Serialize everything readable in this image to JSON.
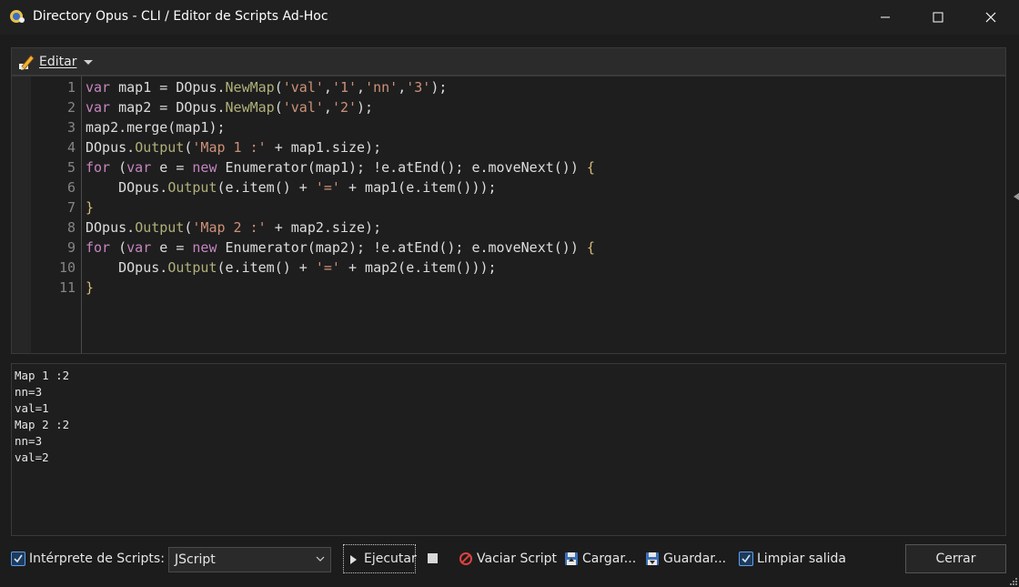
{
  "window": {
    "title": "Directory Opus - CLI / Editor de Scripts Ad-Hoc"
  },
  "toolbar": {
    "edit_label": "Editar"
  },
  "editor": {
    "line_numbers": [
      "1",
      "2",
      "3",
      "4",
      "5",
      "6",
      "7",
      "8",
      "9",
      "10",
      "11"
    ],
    "lines": [
      [
        {
          "t": "kw",
          "v": "var"
        },
        {
          "t": "text",
          "v": " map1 = DOpus."
        },
        {
          "t": "fn",
          "v": "NewMap"
        },
        {
          "t": "text",
          "v": "("
        },
        {
          "t": "str",
          "v": "'val'"
        },
        {
          "t": "text",
          "v": ","
        },
        {
          "t": "str",
          "v": "'1'"
        },
        {
          "t": "text",
          "v": ","
        },
        {
          "t": "str",
          "v": "'nn'"
        },
        {
          "t": "text",
          "v": ","
        },
        {
          "t": "str",
          "v": "'3'"
        },
        {
          "t": "text",
          "v": ");"
        }
      ],
      [
        {
          "t": "kw",
          "v": "var"
        },
        {
          "t": "text",
          "v": " map2 = DOpus."
        },
        {
          "t": "fn",
          "v": "NewMap"
        },
        {
          "t": "text",
          "v": "("
        },
        {
          "t": "str",
          "v": "'val'"
        },
        {
          "t": "text",
          "v": ","
        },
        {
          "t": "str",
          "v": "'2'"
        },
        {
          "t": "text",
          "v": ");"
        }
      ],
      [
        {
          "t": "text",
          "v": "map2.merge(map1);"
        }
      ],
      [
        {
          "t": "text",
          "v": "DOpus."
        },
        {
          "t": "fn",
          "v": "Output"
        },
        {
          "t": "text",
          "v": "("
        },
        {
          "t": "str",
          "v": "'Map 1 :'"
        },
        {
          "t": "text",
          "v": " + map1.size);"
        }
      ],
      [
        {
          "t": "kw",
          "v": "for"
        },
        {
          "t": "text",
          "v": " ("
        },
        {
          "t": "kw",
          "v": "var"
        },
        {
          "t": "text",
          "v": " e = "
        },
        {
          "t": "kw",
          "v": "new"
        },
        {
          "t": "text",
          "v": " Enumerator(map1); !e.atEnd(); e.moveNext()) "
        },
        {
          "t": "brace",
          "v": "{"
        }
      ],
      [
        {
          "t": "text",
          "v": "    DOpus."
        },
        {
          "t": "fn",
          "v": "Output"
        },
        {
          "t": "text",
          "v": "(e.item() + "
        },
        {
          "t": "str",
          "v": "'='"
        },
        {
          "t": "text",
          "v": " + map1(e.item()));"
        }
      ],
      [
        {
          "t": "brace",
          "v": "}"
        }
      ],
      [
        {
          "t": "text",
          "v": "DOpus."
        },
        {
          "t": "fn",
          "v": "Output"
        },
        {
          "t": "text",
          "v": "("
        },
        {
          "t": "str",
          "v": "'Map 2 :'"
        },
        {
          "t": "text",
          "v": " + map2.size);"
        }
      ],
      [
        {
          "t": "kw",
          "v": "for"
        },
        {
          "t": "text",
          "v": " ("
        },
        {
          "t": "kw",
          "v": "var"
        },
        {
          "t": "text",
          "v": " e = "
        },
        {
          "t": "kw",
          "v": "new"
        },
        {
          "t": "text",
          "v": " Enumerator(map2); !e.atEnd(); e.moveNext()) "
        },
        {
          "t": "brace",
          "v": "{"
        }
      ],
      [
        {
          "t": "text",
          "v": "    DOpus."
        },
        {
          "t": "fn",
          "v": "Output"
        },
        {
          "t": "text",
          "v": "(e.item() + "
        },
        {
          "t": "str",
          "v": "'='"
        },
        {
          "t": "text",
          "v": " + map2(e.item()));"
        }
      ],
      [
        {
          "t": "brace",
          "v": "}"
        }
      ]
    ]
  },
  "output": {
    "lines": [
      "Map 1 :2",
      "nn=3",
      "val=1",
      "Map 2 :2",
      "nn=3",
      "val=2"
    ]
  },
  "bottom": {
    "interpreter_label": "Intérprete de Scripts:",
    "interpreter_checked": true,
    "interpreter_value": "JScript",
    "run_label": "Ejecutar",
    "clear_script_label": "Vaciar Script",
    "load_label": "Cargar...",
    "save_label": "Guardar...",
    "clear_output_label": "Limpiar salida",
    "clear_output_checked": true,
    "close_label": "Cerrar"
  },
  "colors": {
    "keyword": "#c586c0",
    "string": "#ce9178",
    "function": "#b0b07a",
    "brace": "#d7ba7d",
    "accent": "#5aa0f0",
    "no_symbol": "#e04040"
  }
}
